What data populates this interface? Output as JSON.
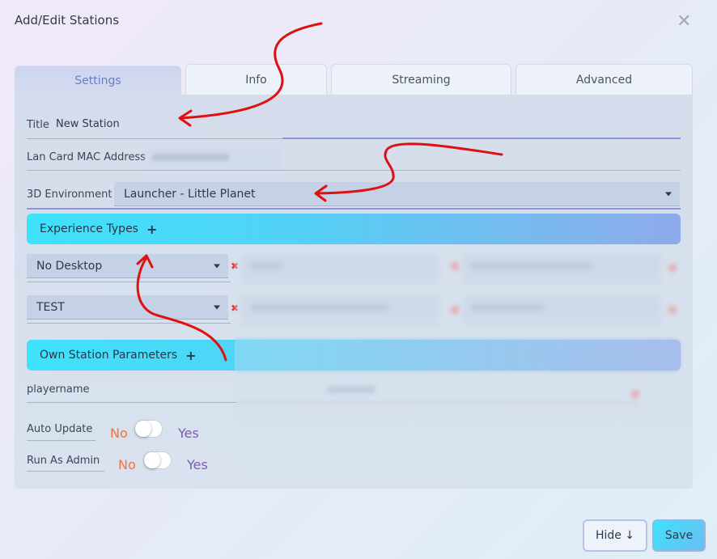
{
  "dialog": {
    "title": "Add/Edit Stations",
    "close_glyph": "✕"
  },
  "tabs": [
    {
      "label": "Settings",
      "active": true
    },
    {
      "label": "Info",
      "active": false
    },
    {
      "label": "Streaming",
      "active": false
    },
    {
      "label": "Advanced",
      "active": false
    }
  ],
  "settings": {
    "title_label": "Title",
    "title_value": "New Station",
    "mac_label": "Lan Card MAC Address",
    "env_label": "3D Environment",
    "env_value": "Launcher - Little Planet"
  },
  "experience_types": {
    "header": "Experience Types",
    "add_glyph": "+",
    "items": [
      "No Desktop",
      "TEST"
    ],
    "remove_glyph": "✖"
  },
  "own_params": {
    "header": "Own Station Parameters",
    "add_glyph": "+",
    "param_name": "playername"
  },
  "toggles": [
    {
      "label": "Auto Update",
      "off": "No",
      "on": "Yes"
    },
    {
      "label": "Run As Admin",
      "off": "No",
      "on": "Yes"
    }
  ],
  "footer": {
    "hide_label": "Hide ↓",
    "save_label": "Save"
  },
  "colors": {
    "accent_cyan": "#3ee2fb",
    "annotation_red": "#e01010",
    "no_orange": "#f0753a",
    "yes_purple": "#7b5cb3"
  }
}
